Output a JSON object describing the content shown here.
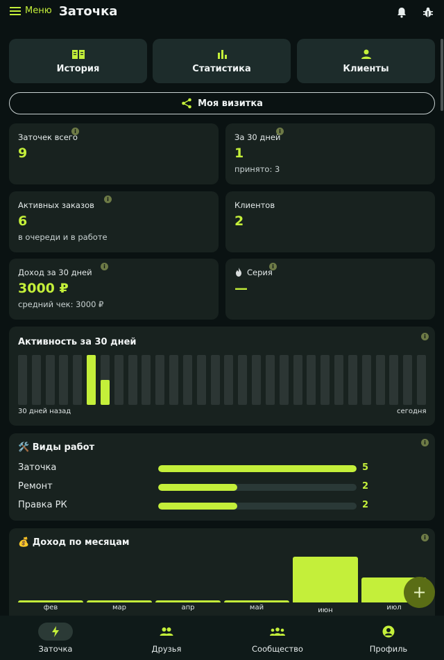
{
  "header": {
    "menu_label": "Меню",
    "title": "Заточка"
  },
  "icons": {
    "menu": "menu-icon",
    "bell": "bell-icon",
    "bug": "bug-icon"
  },
  "nav_cards": [
    {
      "label": "История",
      "icon": "book-icon"
    },
    {
      "label": "Статистика",
      "icon": "bar-chart-icon"
    },
    {
      "label": "Клиенты",
      "icon": "person-icon"
    }
  ],
  "business_card": {
    "label": "Моя визитка",
    "icon": "share-icon"
  },
  "stats": {
    "total": {
      "title": "Заточек всего",
      "value": "9"
    },
    "days30": {
      "title": "За 30 дней",
      "value": "1",
      "sub": "принято: 3"
    },
    "active": {
      "title": "Активных заказов",
      "value": "6",
      "sub": "в очереди и в работе"
    },
    "clients": {
      "title": "Клиентов",
      "value": "2"
    },
    "income": {
      "title": "Доход за 30 дней",
      "value": "3000 ₽",
      "sub": "средний чек: 3000 ₽"
    },
    "streak": {
      "title": "Серия",
      "value": "—",
      "icon": "fire-icon"
    }
  },
  "activity": {
    "title": "Активность за 30 дней",
    "left_label": "30 дней назад",
    "right_label": "сегодня",
    "values": [
      0,
      0,
      0,
      0,
      0,
      1,
      0.5,
      0,
      0,
      0,
      0,
      0,
      0,
      0,
      0,
      0,
      0,
      0,
      0,
      0,
      0,
      0,
      0,
      0,
      0,
      0,
      0,
      0,
      0,
      0
    ]
  },
  "work_types": {
    "title": "🛠️ Виды работ",
    "max": 5,
    "items": [
      {
        "label": "Заточка",
        "value": 5
      },
      {
        "label": "Ремонт",
        "value": 2
      },
      {
        "label": "Правка РК",
        "value": 2
      }
    ]
  },
  "monthly_income": {
    "title": "💰 Доход по месяцам",
    "months": [
      "фев",
      "мар",
      "апр",
      "май",
      "июн",
      "июл"
    ],
    "values": [
      0,
      0,
      0,
      0,
      1,
      0.55
    ]
  },
  "fab": {
    "label": "+"
  },
  "bottom_nav": [
    {
      "label": "Заточка",
      "icon": "bolt-icon",
      "active": true
    },
    {
      "label": "Друзья",
      "icon": "friends-icon",
      "active": false
    },
    {
      "label": "Сообщество",
      "icon": "community-icon",
      "active": false
    },
    {
      "label": "Профиль",
      "icon": "profile-icon",
      "active": false
    }
  ],
  "colors": {
    "accent": "#c4ef3a",
    "card": "#18221f",
    "background": "#0a1212"
  }
}
